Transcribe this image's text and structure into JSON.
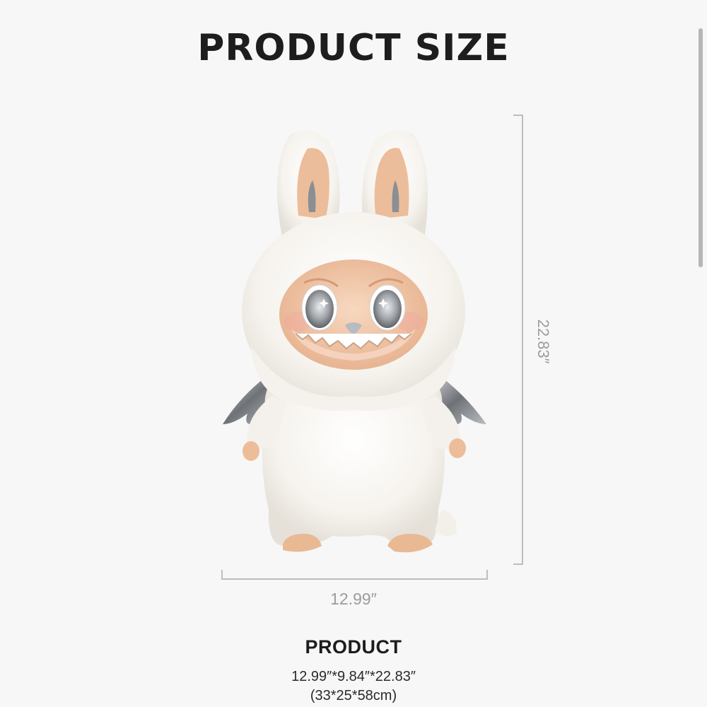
{
  "header": {
    "title": "PRODUCT SIZE"
  },
  "dimensions": {
    "height_label": "22.83″",
    "width_label": "12.99″"
  },
  "product": {
    "section_title": "PRODUCT",
    "size_inches": "12.99″*9.84″*22.83″",
    "size_cm": "(33*25*58cm)"
  },
  "figure": {
    "icon": "plush-figure-icon",
    "colors": {
      "fur": "#fbfaf6",
      "fur_shadow": "#e7e4dd",
      "skin": "#efc3a0",
      "skin_shadow": "#dba582",
      "wing": "#8f9296",
      "eye": "#9fa3a8"
    }
  }
}
